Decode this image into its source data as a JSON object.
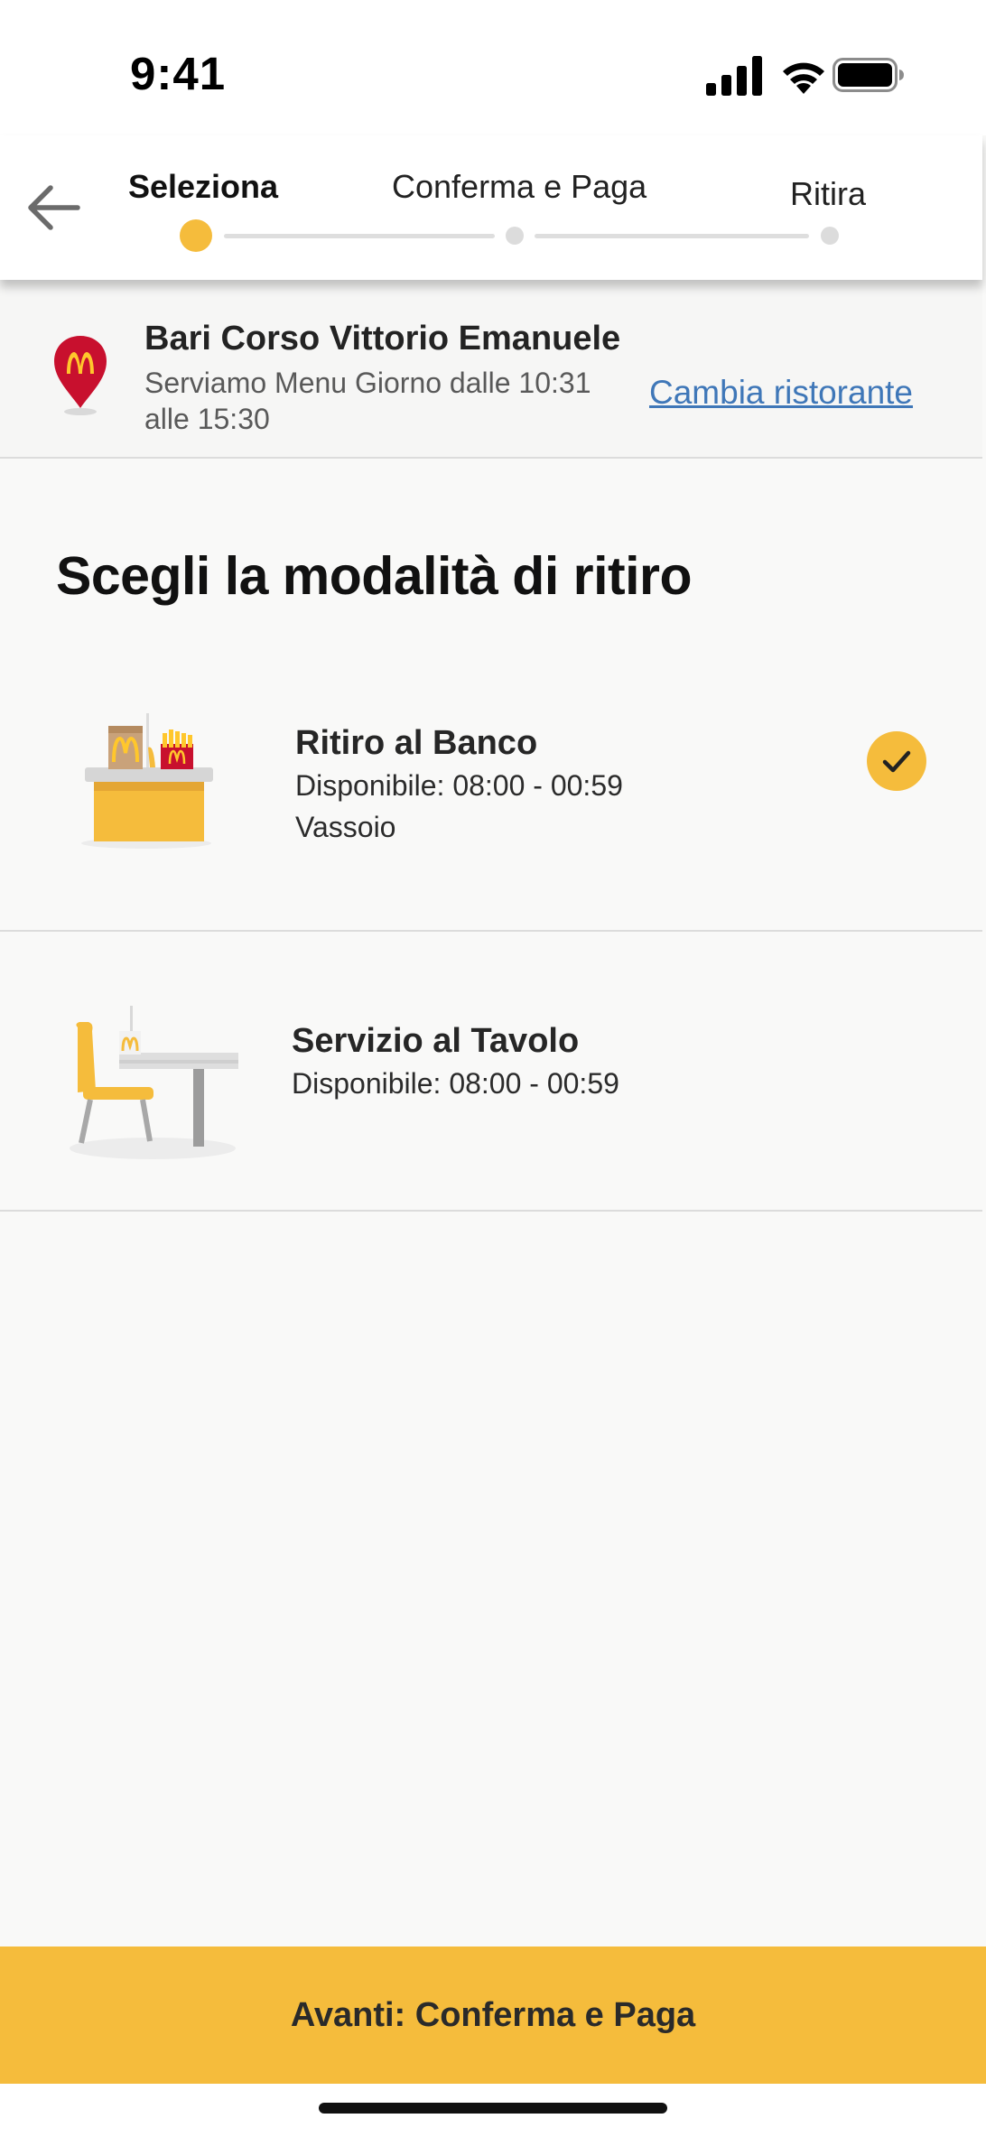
{
  "status_bar": {
    "time": "9:41",
    "icons": [
      "cellular-signal-icon",
      "wifi-icon",
      "battery-icon"
    ]
  },
  "header": {
    "back_icon": "arrow-left-icon",
    "steps": [
      {
        "label": "Seleziona",
        "active": true
      },
      {
        "label": "Conferma e Paga",
        "active": false
      },
      {
        "label": "Ritira",
        "active": false
      }
    ]
  },
  "restaurant": {
    "icon": "mcdonalds-location-pin-icon",
    "name": "Bari Corso Vittorio Emanuele",
    "hours": "Serviamo Menu Giorno dalle 10:31 alle 15:30",
    "change_link": "Cambia ristorante"
  },
  "page_title": "Scegli la modalità di ritiro",
  "options": [
    {
      "icon": "counter-pickup-illustration",
      "title": "Ritiro al Banco",
      "availability": "Disponibile: 08:00 - 00:59",
      "detail": "Vassoio",
      "selected": true
    },
    {
      "icon": "table-service-illustration",
      "title": "Servizio al Tavolo",
      "availability": "Disponibile: 08:00 - 00:59",
      "selected": false
    }
  ],
  "cta": {
    "label": "Avanti: Conferma e Paga"
  },
  "colors": {
    "accent": "#f5bc3c",
    "link": "#3f77b8",
    "brand_red": "#c8102e",
    "background": "#f9f9f8"
  }
}
